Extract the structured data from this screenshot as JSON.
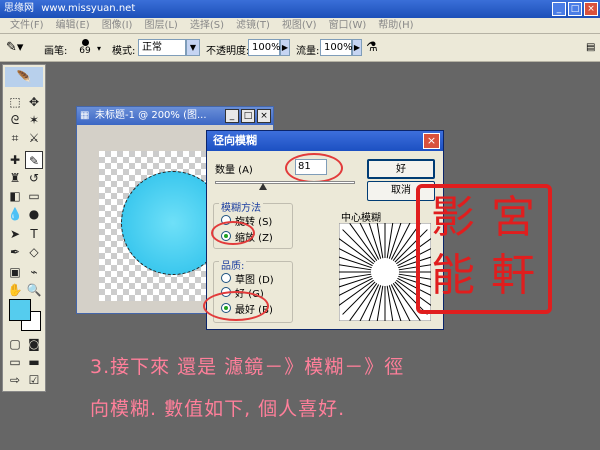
{
  "app": {
    "title": "思缘网",
    "title_suffix": "www.missyuan.net",
    "colors": {
      "titlebar": "#1c4fb8",
      "accent_red": "#e01e1e",
      "instruction": "#ff7f9a",
      "swatch": "#55ccee"
    }
  },
  "menu": {
    "items": [
      "文件(F)",
      "编辑(E)",
      "图像(I)",
      "图层(L)",
      "选择(S)",
      "滤镜(T)",
      "视图(V)",
      "窗口(W)",
      "帮助(H)"
    ]
  },
  "options_bar": {
    "brush_label": "画笔:",
    "brush_size": "69",
    "mode_label": "模式:",
    "mode_value": "正常",
    "opacity_label": "不透明度:",
    "opacity_value": "100%",
    "flow_label": "流量:",
    "flow_value": "100%"
  },
  "document": {
    "title": "未标题-1 @ 200% (图..."
  },
  "dialog": {
    "title": "径向模糊",
    "amount_label": "数量 (A)",
    "amount_value": "81",
    "ok_label": "好",
    "cancel_label": "取消",
    "blur_method_label": "模糊方法",
    "method_spin": "旋转 (S)",
    "method_zoom": "缩放 (Z)",
    "quality_label": "品质:",
    "quality_draft": "草图 (D)",
    "quality_good": "好 (G)",
    "quality_best": "最好 (B)",
    "center_label": "中心模糊"
  },
  "seal": {
    "chars": [
      "宮",
      "軒",
      "能",
      "影"
    ]
  },
  "instructions": {
    "line1": "3.接下來 還是 濾鏡－》模糊－》徑",
    "line2": "向模糊. 數值如下, 個人喜好."
  }
}
